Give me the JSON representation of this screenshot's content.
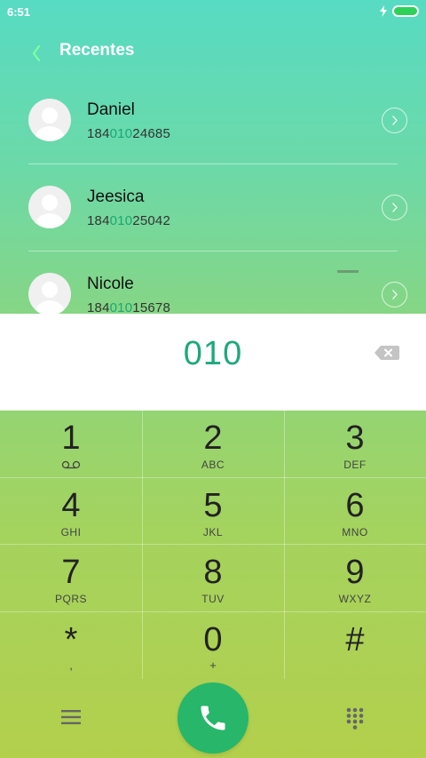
{
  "status_bar": {
    "time": "6:51",
    "battery_level": 1.0
  },
  "header": {
    "back_icon": "chevron-left-icon",
    "title": "Recentes"
  },
  "contacts": [
    {
      "name": "Daniel",
      "number_prefix": "184",
      "number_match": "010",
      "number_suffix": "24685"
    },
    {
      "name": "Jeesica",
      "number_prefix": "184",
      "number_match": "010",
      "number_suffix": "25042"
    },
    {
      "name": "Nicole",
      "number_prefix": "184",
      "number_match": "010",
      "number_suffix": "15678"
    }
  ],
  "dialer": {
    "input": "010",
    "backspace_icon": "backspace-icon"
  },
  "keypad": [
    {
      "digit": "1",
      "sub": "voicemail-icon"
    },
    {
      "digit": "2",
      "sub": "ABC"
    },
    {
      "digit": "3",
      "sub": "DEF"
    },
    {
      "digit": "4",
      "sub": "GHI"
    },
    {
      "digit": "5",
      "sub": "JKL"
    },
    {
      "digit": "6",
      "sub": "MNO"
    },
    {
      "digit": "7",
      "sub": "PQRS"
    },
    {
      "digit": "8",
      "sub": "TUV"
    },
    {
      "digit": "9",
      "sub": "WXYZ"
    },
    {
      "digit": "*",
      "sub": ","
    },
    {
      "digit": "0",
      "sub": "+"
    },
    {
      "digit": "#",
      "sub": ""
    }
  ],
  "bottom": {
    "menu_icon": "menu-icon",
    "call_icon": "phone-icon",
    "dialpad_icon": "dialpad-grid-icon"
  },
  "colors": {
    "accent": "#1ea97a",
    "call_button": "#27b66a",
    "battery": "#2ed158"
  }
}
